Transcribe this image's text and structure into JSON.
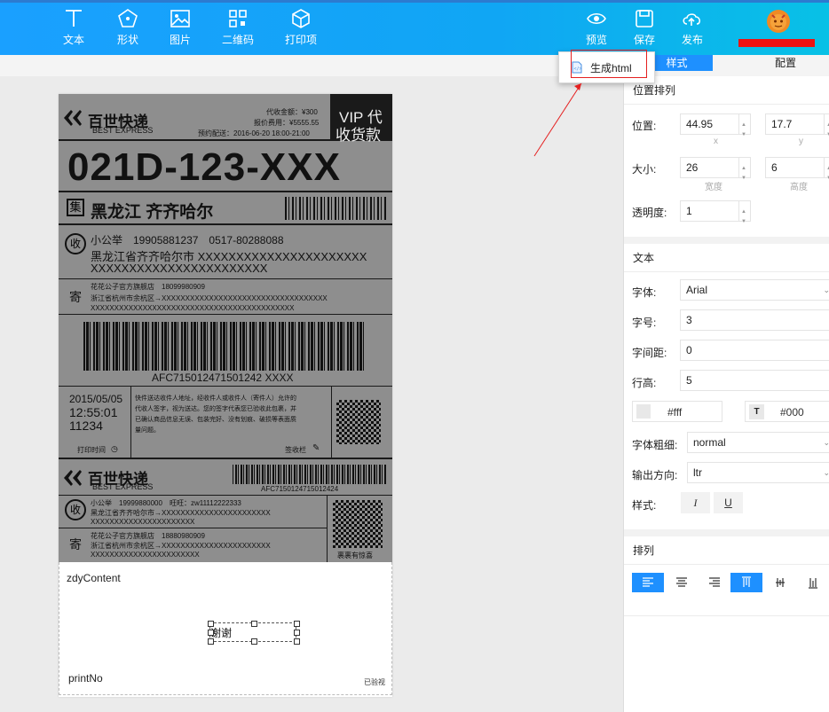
{
  "toolbar": {
    "left": [
      {
        "label": "文本",
        "icon": "text-icon"
      },
      {
        "label": "形状",
        "icon": "shape-icon"
      },
      {
        "label": "图片",
        "icon": "image-icon"
      },
      {
        "label": "二维码",
        "icon": "qrcode-icon"
      },
      {
        "label": "打印项",
        "icon": "box-icon"
      }
    ],
    "right": [
      {
        "label": "预览",
        "icon": "eye-icon"
      },
      {
        "label": "保存",
        "icon": "save-icon"
      },
      {
        "label": "发布",
        "icon": "upload-cloud-icon"
      }
    ]
  },
  "dropdown": {
    "item": "生成html"
  },
  "panel_tabs": {
    "style": "样式",
    "config": "配置"
  },
  "panel": {
    "position_section": {
      "title": "位置排列",
      "position_label": "位置:",
      "x_value": "44.95",
      "x_sub": "x",
      "y_value": "17.7",
      "y_sub": "y",
      "size_label": "大小:",
      "width_value": "26",
      "width_sub": "宽度",
      "height_value": "6",
      "height_sub": "高度",
      "opacity_label": "透明度:",
      "opacity_value": "1"
    },
    "text_section": {
      "title": "文本",
      "font_label": "字体:",
      "font_value": "Arial",
      "size_label": "字号:",
      "size_value": "3",
      "spacing_label": "字间距:",
      "spacing_value": "0",
      "line_height_label": "行高:",
      "line_height_value": "5",
      "bg_color": "#fff",
      "font_color": "#000",
      "font_color_btn": "T",
      "weight_label": "字体粗细:",
      "weight_value": "normal",
      "direction_label": "输出方向:",
      "direction_value": "ltr",
      "style_label": "样式:",
      "italic_btn": "I",
      "underline_btn": "U"
    },
    "align_section": {
      "title": "排列"
    }
  },
  "label": {
    "header": {
      "brand_cn": "百世快递",
      "brand_en": "BEST EXPRESS",
      "cod_amount": "代收金额：¥300",
      "insured": "报价费用：¥5555.55",
      "appointment": "预约配送：2016-06-20 18:00-21:00",
      "vip_line1": "VIP 代",
      "vip_line2": "收货款"
    },
    "route_code": "021D-123-XXX",
    "dest_tag": "集",
    "destination": "黑龙江 齐齐哈尔",
    "receiver": {
      "tag": "收",
      "name_phone": "小公举　19905881237　0517-80288088",
      "address1": "黑龙江省齐齐哈尔市 XXXXXXXXXXXXXXXXXXXXXX",
      "address2": "XXXXXXXXXXXXXXXXXXXXXXX"
    },
    "sender": {
      "tag": "寄",
      "name_phone": "花花公子官方旗舰店　18099980909",
      "address1": "浙江省杭州市余杭区→XXXXXXXXXXXXXXXXXXXXXXXXXXXXXXXXXXX",
      "address2": "XXXXXXXXXXXXXXXXXXXXXXXXXXXXXXXXXXXXXXXXXXX"
    },
    "tracking": "AFC715012471501242 XXXX",
    "print_date": "2015/05/05",
    "print_time": "12:55:01",
    "print_id": "11234",
    "print_time_label": "打印时间",
    "notice1": "快件送达收件人地址，经收件人或收件人（寄件人）允许的",
    "notice2": "代收人签字，视为送达。您的签字代表您已验收此包裹，并",
    "notice3": "已确认商品信息无误、包装完好、没有划痕、破损等表面质",
    "notice4": "量问题。",
    "sign_label": "签收栏",
    "stub": {
      "brand_cn": "百世快递",
      "brand_en": "BEST EXPRESS",
      "tracking": "AFC7150124715012424",
      "recv_tag": "收",
      "recv_line1": "小公举　19999880000　旺旺：zw11112222333",
      "recv_line2": "黑龙江省齐齐哈尔市→XXXXXXXXXXXXXXXXXXXXXXX",
      "recv_line3": "XXXXXXXXXXXXXXXXXXXXXX",
      "send_tag": "寄",
      "send_line1": "花花公子官方旗舰店　18880980909",
      "send_line2": "浙江省杭州市余杭区→XXXXXXXXXXXXXXXXXXXXXXX",
      "send_line3": "XXXXXXXXXXXXXXXXXXXXXXX",
      "qr_caption": "裹裹有惊喜"
    },
    "custom": {
      "zdy": "zdyContent",
      "selected_text": "谢谢",
      "print_no": "printNo",
      "verified": "已验视"
    }
  }
}
